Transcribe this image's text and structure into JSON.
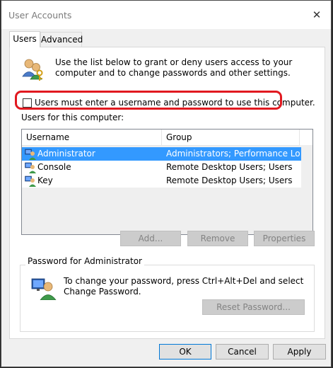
{
  "window": {
    "title": "User Accounts"
  },
  "tabs": [
    {
      "label": "Users",
      "active": true
    },
    {
      "label": "Advanced",
      "active": false
    }
  ],
  "description": "Use the list below to grant or deny users access to your computer and to change passwords and other settings.",
  "require_login_checkbox": {
    "label": "Users must enter a username and password to use this computer.",
    "checked": false
  },
  "users_list": {
    "label": "Users for this computer:",
    "columns": [
      "Username",
      "Group"
    ],
    "rows": [
      {
        "username": "Administrator",
        "group": "Administrators; Performance Log...",
        "selected": true
      },
      {
        "username": "Console",
        "group": "Remote Desktop Users; Users",
        "selected": false
      },
      {
        "username": "Key",
        "group": "Remote Desktop Users; Users",
        "selected": false
      }
    ]
  },
  "list_buttons": {
    "add": "Add...",
    "remove": "Remove",
    "properties": "Properties"
  },
  "password_group": {
    "legend": "Password for Administrator",
    "text": "To change your password, press Ctrl+Alt+Del and select Change Password.",
    "reset_button": "Reset Password..."
  },
  "footer": {
    "ok": "OK",
    "cancel": "Cancel",
    "apply": "Apply"
  },
  "colors": {
    "selection": "#3399ff",
    "highlight_outline": "#e11920"
  }
}
